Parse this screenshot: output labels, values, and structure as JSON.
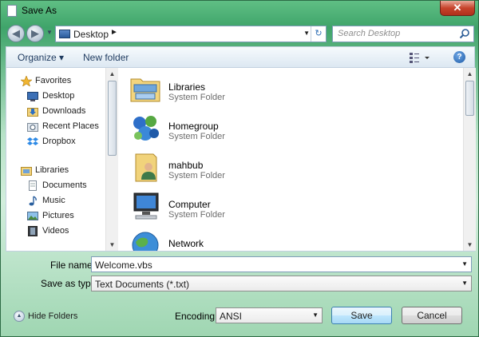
{
  "window": {
    "title": "Save As",
    "close_glyph": "✕"
  },
  "nav": {
    "back_icon": "back-arrow-icon",
    "forward_icon": "forward-arrow-icon",
    "address": "Desktop",
    "address_sep": "►",
    "search_placeholder": "Search Desktop"
  },
  "toolbar": {
    "organize_label": "Organize ▾",
    "new_folder_label": "New folder",
    "help_label": "?"
  },
  "sidebar": {
    "items": [
      {
        "label": "Favorites",
        "icon": "star-icon"
      },
      {
        "label": "Desktop",
        "icon": "desktop-icon"
      },
      {
        "label": "Downloads",
        "icon": "downloads-icon"
      },
      {
        "label": "Recent Places",
        "icon": "recent-places-icon"
      },
      {
        "label": "Dropbox",
        "icon": "dropbox-icon"
      },
      {
        "label": "Libraries",
        "icon": "libraries-icon"
      },
      {
        "label": "Documents",
        "icon": "documents-icon"
      },
      {
        "label": "Music",
        "icon": "music-icon"
      },
      {
        "label": "Pictures",
        "icon": "pictures-icon"
      },
      {
        "label": "Videos",
        "icon": "videos-icon"
      }
    ]
  },
  "files": [
    {
      "name": "Libraries",
      "type": "System Folder",
      "icon": "libraries-folder-icon"
    },
    {
      "name": "Homegroup",
      "type": "System Folder",
      "icon": "homegroup-icon"
    },
    {
      "name": "mahbub",
      "type": "System Folder",
      "icon": "user-folder-icon"
    },
    {
      "name": "Computer",
      "type": "System Folder",
      "icon": "computer-icon"
    },
    {
      "name": "Network",
      "type": "",
      "icon": "network-icon"
    }
  ],
  "form": {
    "filename_label": "File name:",
    "filename_value": "Welcome.vbs",
    "savetype_label": "Save as type:",
    "savetype_value": "Text Documents (*.txt)",
    "encoding_label": "Encoding:",
    "encoding_value": "ANSI"
  },
  "footer": {
    "hide_folders_label": "Hide Folders",
    "save_label": "Save",
    "cancel_label": "Cancel"
  },
  "colors": {
    "accent": "#3c7fb1",
    "frame": "#3fa46a"
  }
}
